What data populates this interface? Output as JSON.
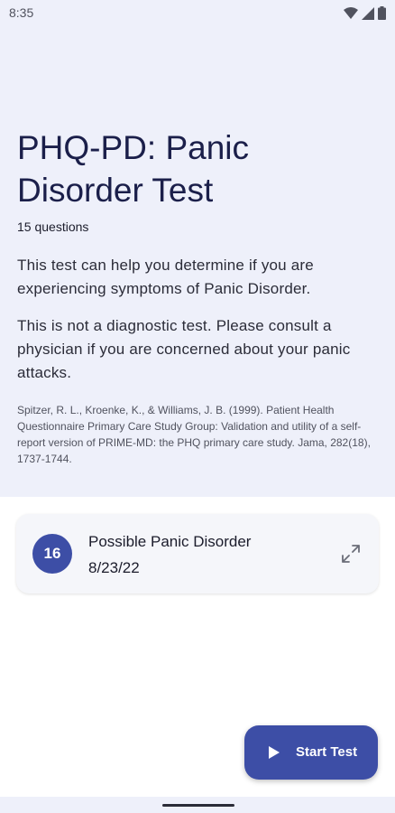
{
  "status_bar": {
    "time": "8:35",
    "icons": [
      "wifi-icon",
      "signal-icon",
      "battery-icon"
    ]
  },
  "test": {
    "title": "PHQ-PD: Panic Disorder Test",
    "question_count": "15 questions",
    "description": "This test can help you determine if you are experiencing symptoms of Panic Disorder.",
    "disclaimer": "This is not a diagnostic test. Please consult a physician if you are concerned about your panic attacks.",
    "citation": "Spitzer, R. L., Kroenke, K., & Williams, J. B. (1999). Patient Health Questionnaire Primary Care Study Group: Validation and utility of a self-report version of PRIME-MD: the PHQ primary care study. Jama, 282(18), 1737-1744."
  },
  "result": {
    "score": "16",
    "label": "Possible Panic Disorder",
    "date": "8/23/22",
    "expand_icon": "expand-icon"
  },
  "fab": {
    "label": "Start Test",
    "icon": "play-icon"
  },
  "colors": {
    "accent": "#3d4ea6",
    "header_bg": "#eef0fa",
    "title": "#1b1f4a"
  }
}
